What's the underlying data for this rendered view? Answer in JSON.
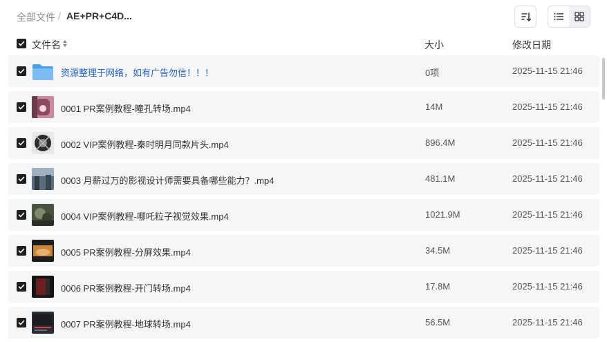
{
  "breadcrumb": {
    "root": "全部文件",
    "separator": "/",
    "current": "AE+PR+C4D..."
  },
  "columns": {
    "name": "文件名",
    "size": "大小",
    "date": "修改日期"
  },
  "rows": [
    {
      "name": "资源整理于网络，如有广告勿信！！！",
      "size": "0项",
      "date": "2025-11-15 21:46",
      "thumb": "folder",
      "is_link": true
    },
    {
      "name": "0001 PR案例教程-瞳孔转场.mp4",
      "size": "14M",
      "date": "2025-11-15 21:46",
      "thumb": "video"
    },
    {
      "name": "0002 VIP案例教程-秦时明月同款片头.mp4",
      "size": "896.4M",
      "date": "2025-11-15 21:46",
      "thumb": "video"
    },
    {
      "name": "0003 月薪过万的影视设计师需要具备哪些能力？.mp4",
      "size": "481.1M",
      "date": "2025-11-15 21:46",
      "thumb": "video"
    },
    {
      "name": "0004 VIP案例教程-哪吒粒子视觉效果.mp4",
      "size": "1021.9M",
      "date": "2025-11-15 21:46",
      "thumb": "video"
    },
    {
      "name": "0005 PR案例教程-分屏效果.mp4",
      "size": "34.5M",
      "date": "2025-11-15 21:46",
      "thumb": "video"
    },
    {
      "name": "0006 PR案例教程-开门转场.mp4",
      "size": "17.8M",
      "date": "2025-11-15 21:46",
      "thumb": "video"
    },
    {
      "name": "0007 PR案例教程-地球转场.mp4",
      "size": "56.5M",
      "date": "2025-11-15 21:46",
      "thumb": "video"
    }
  ],
  "icons": {
    "sort": "sort-descending-icon",
    "list_view": "list-view-icon",
    "grid_view": "grid-view-icon",
    "column_sort": "column-sort-icon",
    "checkbox": "checkbox-checked-icon",
    "folder": "folder-icon"
  },
  "colors": {
    "link": "#2463d4",
    "row_bg": "#f5f6f7",
    "checkbox": "#1f1f1f",
    "folder": "#5aa8f0"
  },
  "selection": {
    "all_checked": true
  }
}
